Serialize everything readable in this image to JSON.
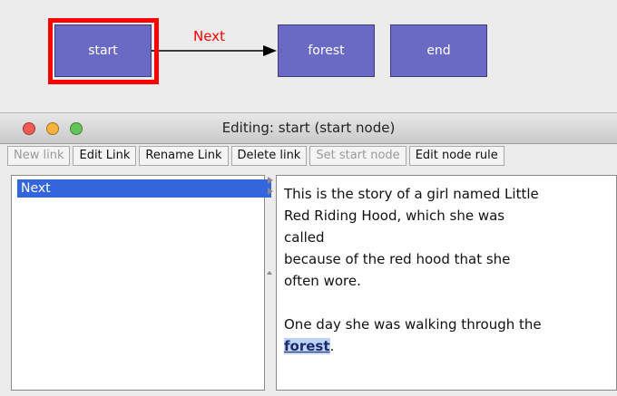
{
  "graph": {
    "nodes": {
      "start": "start",
      "forest": "forest",
      "end": "end"
    },
    "edge_label": "Next",
    "colors": {
      "node_fill": "#6a6ac4",
      "selection": "#ff0000",
      "edge_label": "#ff0000"
    }
  },
  "window": {
    "title": "Editing: start (start node)",
    "toolbar": {
      "new_link": "New link",
      "edit_link": "Edit Link",
      "rename_link": "Rename Link",
      "delete_link": "Delete link",
      "set_start_node": "Set start node",
      "edit_node_rule": "Edit node rule"
    },
    "links_list": [
      "Next"
    ],
    "story": {
      "line1": "This is the story of a girl named Little",
      "line2": "Red Riding Hood, which she was",
      "line3": "called",
      "line4": "because of the red hood that she",
      "line5": "often wore.",
      "line6": "One day she was walking through the",
      "link_text": "forest",
      "after_link": "."
    }
  }
}
